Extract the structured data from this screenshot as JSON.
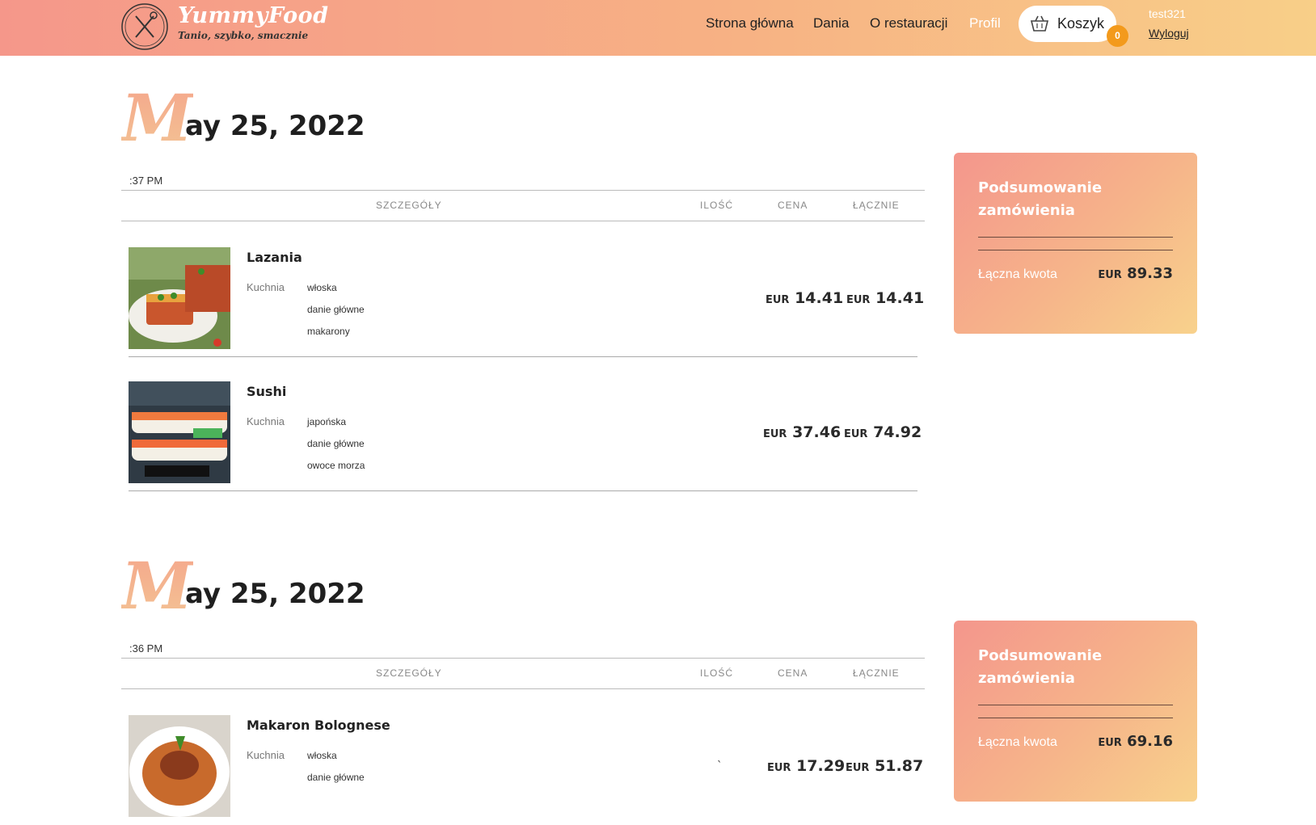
{
  "header": {
    "brand": "YummyFood",
    "tagline": "Tanio, szybko, smacznie",
    "nav": [
      "Strona główna",
      "Dania",
      "O restauracji",
      "Profil"
    ],
    "cart_label": "Koszyk",
    "cart_count": "0",
    "username": "test321",
    "logout": "Wyloguj"
  },
  "colors": {
    "accent_orange": "#f39a1c",
    "gradient_start": "#f5978a",
    "gradient_end": "#f8cf88"
  },
  "table_headers": [
    "Szczegóły",
    "Ilość",
    "Cena",
    "Łącznie"
  ],
  "orders": [
    {
      "date_first_letter": "M",
      "date_rest": "ay 25, 2022",
      "time": ":37 PM",
      "items": [
        {
          "name": "Lazania",
          "cuisine_label": "Kuchnia",
          "tags": [
            "włoska",
            "danie główne",
            "makarony"
          ],
          "quantity": "",
          "price_currency": "EUR",
          "price": "14.41",
          "total_currency": "EUR",
          "total": "14.41"
        },
        {
          "name": "Sushi",
          "cuisine_label": "Kuchnia",
          "tags": [
            "japońska",
            "danie główne",
            "owoce morza"
          ],
          "quantity": "",
          "price_currency": "EUR",
          "price": "37.46",
          "total_currency": "EUR",
          "total": "74.92"
        }
      ],
      "summary": {
        "title": "Podsumowanie zamówienia",
        "total_label": "Łączna kwota",
        "currency": "EUR",
        "total": "89.33"
      }
    },
    {
      "date_first_letter": "M",
      "date_rest": "ay 25, 2022",
      "time": ":36 PM",
      "items": [
        {
          "name": "Makaron Bolognese",
          "cuisine_label": "Kuchnia",
          "tags": [
            "włoska",
            "danie główne"
          ],
          "quantity": "`",
          "price_currency": "EUR",
          "price": "17.29",
          "total_currency": "EUR",
          "total": "51.87"
        }
      ],
      "summary": {
        "title": "Podsumowanie zamówienia",
        "total_label": "Łączna kwota",
        "currency": "EUR",
        "total": "69.16"
      }
    }
  ]
}
